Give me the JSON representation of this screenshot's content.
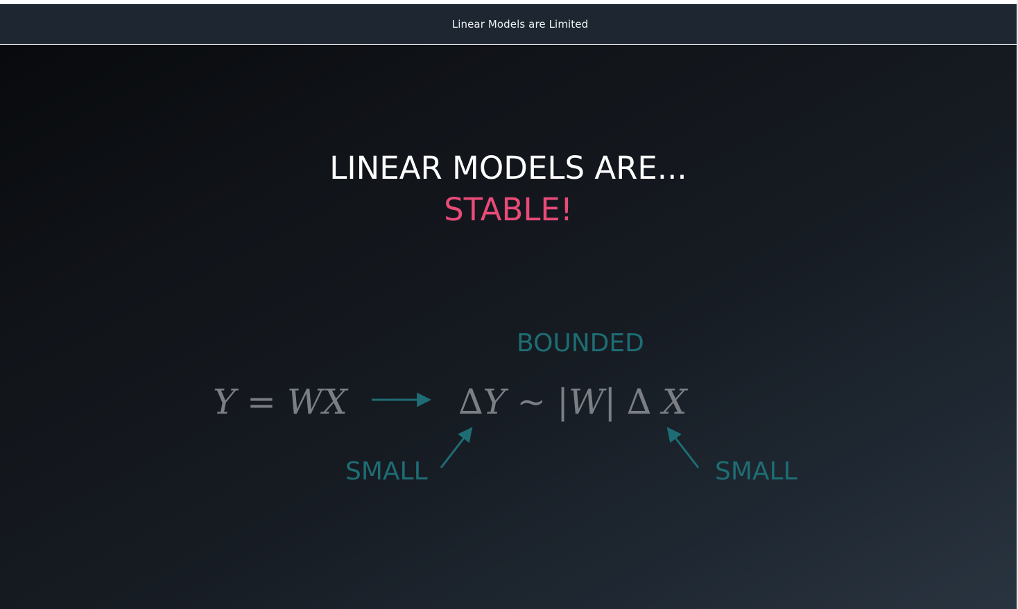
{
  "window": {
    "title": "Linear Models are Limited"
  },
  "slide": {
    "headline": "LINEAR MODELS ARE...",
    "headline_highlight": "STABLE!",
    "equation_left": "Y = WX",
    "equation_right": "∆Y ~ |W| ∆ X",
    "label_bounded": "BOUNDED",
    "label_small_left": "SMALL",
    "label_small_right": "SMALL"
  },
  "colors": {
    "title_bar": "#1e2731",
    "highlight": "#e94b79",
    "teal": "#1e6d74",
    "equation": "#7b7f85"
  }
}
